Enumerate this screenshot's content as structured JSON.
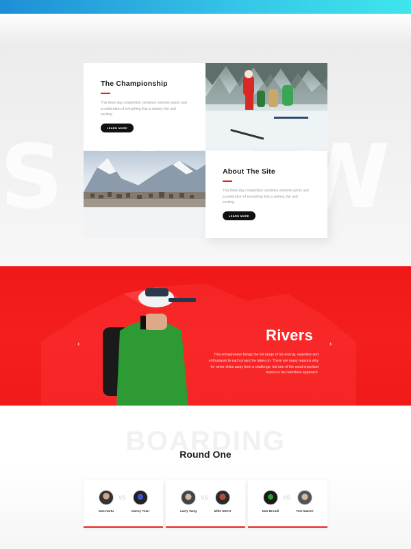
{
  "header": {
    "accent_colors": [
      "#1e8ed6",
      "#3ee6ec"
    ]
  },
  "intro": {
    "background_word": "SNOW",
    "cards": [
      {
        "title": "The Championship",
        "body": "This three day competition combines extreme sports and a celebration of everything that is wintery, fun and exciting",
        "button": "LEARN MORE"
      },
      {
        "title": "About The Site",
        "body": "This three day competition combines extreme sports and a celebration of everything that is wintery, fun and exciting",
        "button": "LEARN MORE"
      }
    ]
  },
  "slider": {
    "title": "Rivers",
    "text": "This entrepreneur brings the full range of his energy, expertise and enthusiasm to each project he takes on. There are many reasons why he never shies away from a challenge, but one of the most important reason is his relentless approach.",
    "prev_icon": "chevron-left-icon",
    "next_icon": "chevron-right-icon",
    "prev_glyph": "‹",
    "next_glyph": "›",
    "accent": "#f01818"
  },
  "boarding": {
    "background_word": "BOARDING",
    "round_title": "Round One",
    "vs_label": "VS",
    "matches": [
      {
        "player_a": "Dan Kartu",
        "player_b": "Danny Yean"
      },
      {
        "player_a": "Larry Vang",
        "player_b": "Mike Steerr"
      },
      {
        "player_a": "Dan Broudi",
        "player_b": "Tom Macerr"
      }
    ]
  }
}
